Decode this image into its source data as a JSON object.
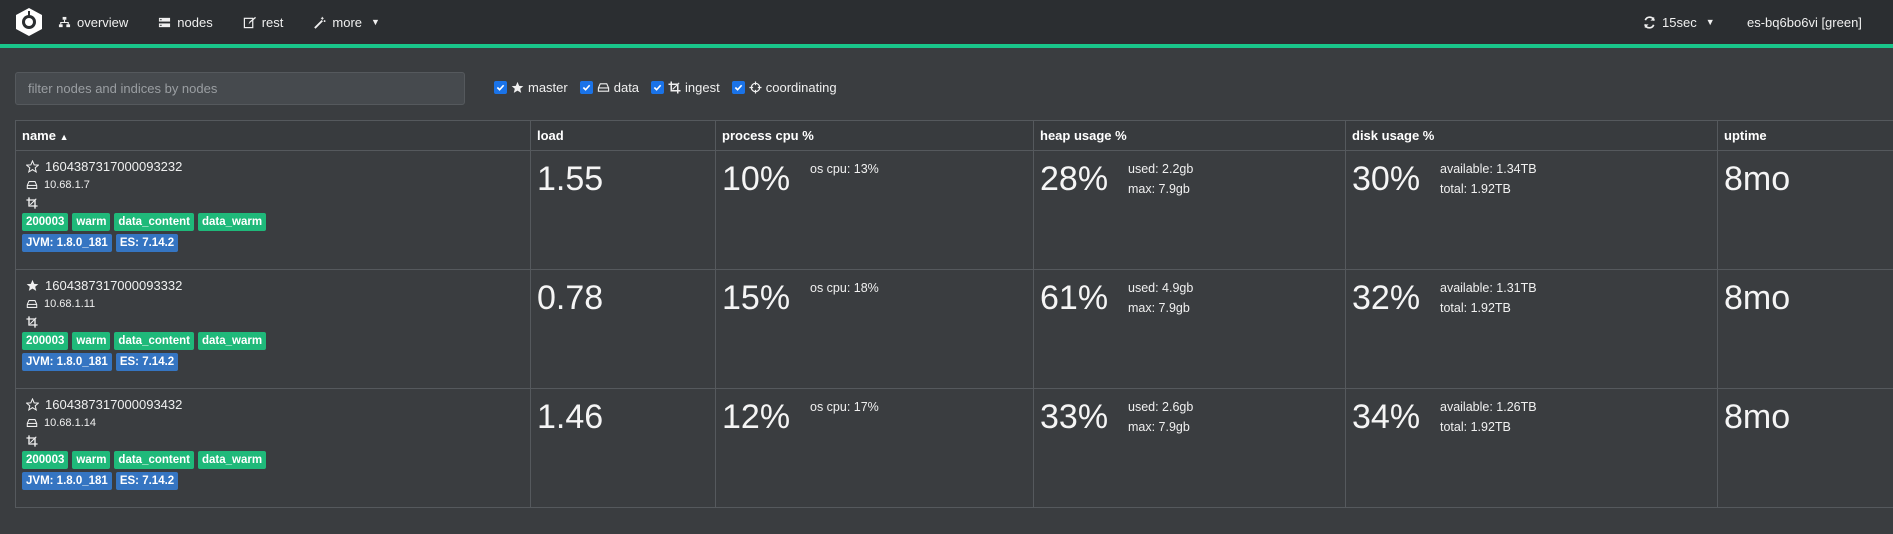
{
  "nav": {
    "items": [
      {
        "label": "overview",
        "icon": "sitemap-icon"
      },
      {
        "label": "nodes",
        "icon": "server-icon"
      },
      {
        "label": "rest",
        "icon": "edit-icon"
      },
      {
        "label": "more",
        "icon": "magic-wand-icon"
      }
    ],
    "refresh": "15sec",
    "cluster": "es-bq6bo6vi [green]"
  },
  "filter": {
    "placeholder": "filter nodes and indices by nodes"
  },
  "roles": [
    {
      "label": "master",
      "checked": true,
      "icon": "star-icon"
    },
    {
      "label": "data",
      "checked": true,
      "icon": "hdd-icon"
    },
    {
      "label": "ingest",
      "checked": true,
      "icon": "crop-icon"
    },
    {
      "label": "coordinating",
      "checked": true,
      "icon": "crosshairs-icon"
    }
  ],
  "table": {
    "headers": [
      "name",
      "load",
      "process cpu %",
      "heap usage %",
      "disk usage %",
      "uptime"
    ],
    "rows": [
      {
        "name": "1604387317000093232",
        "master_icon": "star-outline-icon",
        "ip": "10.68.1.7",
        "tags": [
          "200003",
          "warm",
          "data_content",
          "data_warm"
        ],
        "jvm": "JVM: 1.8.0_181",
        "es": "ES: 7.14.2",
        "load": "1.55",
        "cpu": "10%",
        "os_cpu": "os cpu: 13%",
        "heap": "28%",
        "heap_used": "used: 2.2gb",
        "heap_max": "max: 7.9gb",
        "disk": "30%",
        "disk_avail": "available: 1.34TB",
        "disk_total": "total: 1.92TB",
        "uptime": "8mo"
      },
      {
        "name": "1604387317000093332",
        "master_icon": "star-solid-icon",
        "ip": "10.68.1.11",
        "tags": [
          "200003",
          "warm",
          "data_content",
          "data_warm"
        ],
        "jvm": "JVM: 1.8.0_181",
        "es": "ES: 7.14.2",
        "load": "0.78",
        "cpu": "15%",
        "os_cpu": "os cpu: 18%",
        "heap": "61%",
        "heap_used": "used: 4.9gb",
        "heap_max": "max: 7.9gb",
        "disk": "32%",
        "disk_avail": "available: 1.31TB",
        "disk_total": "total: 1.92TB",
        "uptime": "8mo"
      },
      {
        "name": "1604387317000093432",
        "master_icon": "star-outline-icon",
        "ip": "10.68.1.14",
        "tags": [
          "200003",
          "warm",
          "data_content",
          "data_warm"
        ],
        "jvm": "JVM: 1.8.0_181",
        "es": "ES: 7.14.2",
        "load": "1.46",
        "cpu": "12%",
        "os_cpu": "os cpu: 17%",
        "heap": "33%",
        "heap_used": "used: 2.6gb",
        "heap_max": "max: 7.9gb",
        "disk": "34%",
        "disk_avail": "available: 1.26TB",
        "disk_total": "total: 1.92TB",
        "uptime": "8mo"
      }
    ]
  },
  "colors": {
    "accent": "#19c58a",
    "tag_green": "#1fb97a",
    "tag_blue": "#3575c2",
    "checkbox": "#1a73e8"
  }
}
